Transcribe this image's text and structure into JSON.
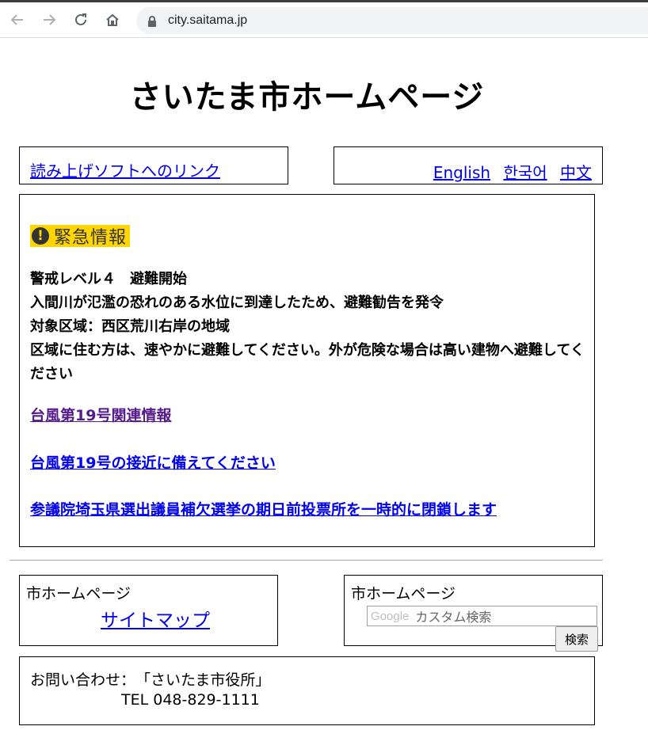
{
  "browser": {
    "url": "city.saitama.jp",
    "back_icon": "arrow-left-icon",
    "forward_icon": "arrow-right-icon",
    "reload_icon": "reload-icon",
    "home_icon": "home-icon",
    "lock_icon": "lock-icon"
  },
  "page": {
    "title": "さいたま市ホームページ"
  },
  "reader": {
    "link": "読み上げソフトへのリンク"
  },
  "languages": [
    "English",
    "한국어",
    "中文"
  ],
  "emergency": {
    "badge": "緊急情報",
    "badge_color": "#ffd500",
    "lines": [
      "警戒レベル４　避難開始",
      "入間川が氾濫の恐れのある水位に到達したため、避難勧告を発令",
      "対象区域：西区荒川右岸の地域",
      "区域に住む方は、速やかに避難してください。外が危険な場合は高い建物へ避難してください"
    ],
    "links": [
      "台風第19号関連情報",
      "台風第19号の接近に備えてください",
      "参議院埼玉県選出議員補欠選挙の期日前投票所を一時的に閉鎖します"
    ]
  },
  "sitemap": {
    "label": "市ホームページ",
    "link": "サイトマップ"
  },
  "search": {
    "label": "市ホームページ",
    "google": "Google",
    "placeholder": "カスタム検索",
    "button": "検索"
  },
  "contact": {
    "line1": "お問い合わせ：　「さいたま市役所」",
    "line2": "TEL 048-829-1111"
  }
}
